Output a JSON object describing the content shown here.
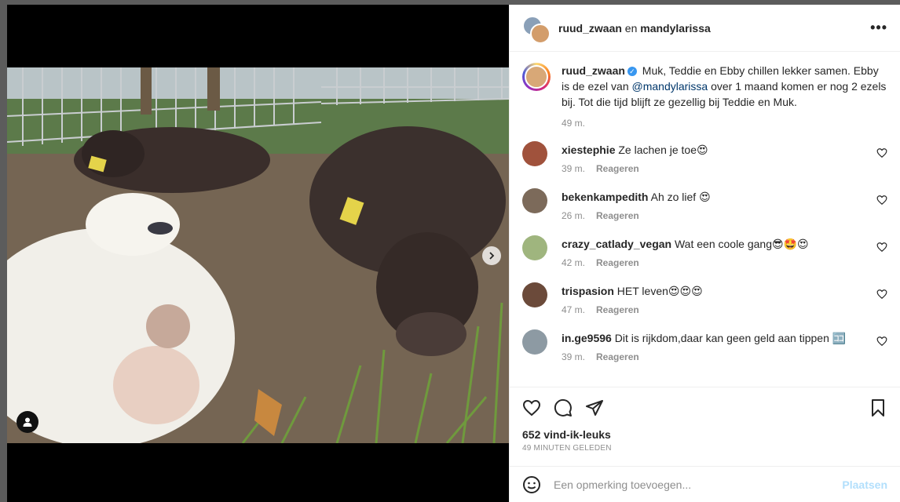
{
  "colors": {
    "accent": "#0095f6",
    "link": "#00376b",
    "muted": "#8e8e8e",
    "text": "#262626"
  },
  "header": {
    "user1": "ruud_zwaan",
    "separator": " en ",
    "user2": "mandylarissa",
    "more_icon": "more-horizontal-icon"
  },
  "caption": {
    "username": "ruud_zwaan",
    "text_part1": " Muk, Teddie en Ebby chillen lekker samen. Ebby is de ezel van ",
    "mention": "@mandylarissa",
    "text_part2": " over 1 maand komen er nog 2 ezels bij. Tot die tijd blijft ze gezellig bij Teddie en Muk.",
    "time": "49 m."
  },
  "reply_label": "Reageren",
  "comments": [
    {
      "username": "xiestephie",
      "text": " Ze lachen je toe😍",
      "time": "39 m.",
      "avatar_color": "#a0523c"
    },
    {
      "username": "bekenkampedith",
      "text": " Ah zo lief 😍",
      "time": "26 m.",
      "avatar_color": "#7c6a5a"
    },
    {
      "username": "crazy_catlady_vegan",
      "text": " Wat een coole gang😎🤩😍",
      "time": "42 m.",
      "avatar_color": "#9fb57e"
    },
    {
      "username": "trispasion",
      "text": " HET leven😍😍😍",
      "time": "47 m.",
      "avatar_color": "#6b4a3a"
    },
    {
      "username": "in.ge9596",
      "text": " Dit is rijkdom,daar kan geen geld aan tippen 🈁",
      "time": "39 m.",
      "avatar_color": "#8d9aa3"
    }
  ],
  "actions": {
    "like_icon": "heart-icon",
    "comment_icon": "comment-icon",
    "share_icon": "paper-plane-icon",
    "save_icon": "bookmark-icon"
  },
  "likes": "652 vind-ik-leuks",
  "posted_ago": "49 MINUTEN GELEDEN",
  "add_comment": {
    "placeholder": "Een opmerking toevoegen...",
    "post_label": "Plaatsen",
    "emoji_icon": "smiley-icon"
  }
}
